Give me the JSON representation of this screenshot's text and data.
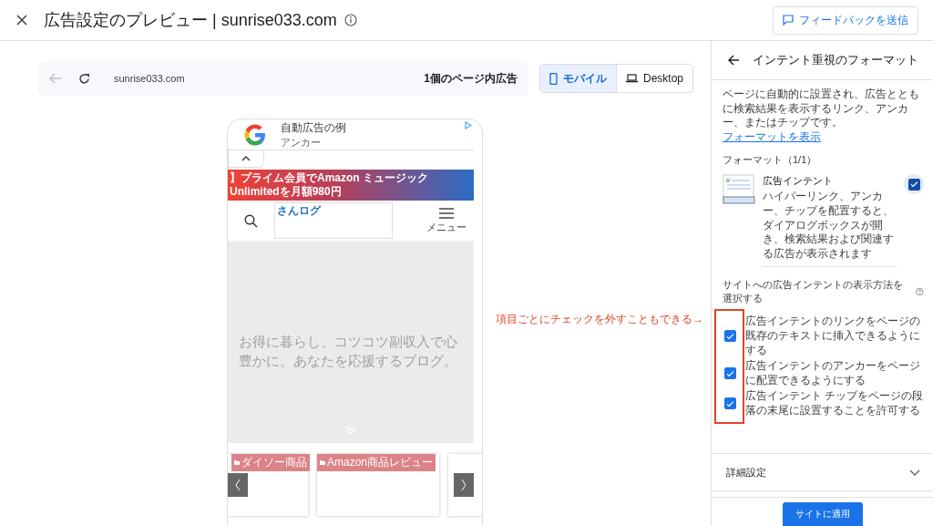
{
  "header": {
    "title": "広告設定のプレビュー | sunrise033.com",
    "feedback_button": "フィードバックを送信"
  },
  "browser_bar": {
    "url": "sunrise033.com",
    "ad_count": "1個のページ内広告",
    "back_disabled": true
  },
  "device_tabs": [
    {
      "label": "モバイル",
      "kind": "mobile",
      "selected": true
    },
    {
      "label": "Desktop",
      "kind": "desktop",
      "selected": false
    }
  ],
  "preview": {
    "anchor_ad": {
      "title": "自動広告の例",
      "subtitle": "アンカー"
    },
    "banner": "】プライム会員でAmazon ミュージック Unlimitedを月額980円",
    "site_logo": "さんログ",
    "menu_label": "メニュー",
    "hero_text": "お得に暮らし、コツコツ副収入で心豊かに。あなたを応援するブログ。",
    "carousel_tags": [
      "ダイソー商品",
      "Amazon商品レビュー"
    ]
  },
  "panel": {
    "title": "インテント重視のフォーマット",
    "description": "ページに自動的に設置され、広告とともに検索結果を表示するリンク、アンカー、またはチップです。",
    "description_link": "フォーマットを表示",
    "formats_heading": "フォーマット（1/1）",
    "format": {
      "title": "広告インテント",
      "description": "ハイパーリンク、アンカー、チップを配置すると、ダイアログボックスが開き、検索結果および関連する広告が表示されます",
      "checked": true
    },
    "options_heading": "サイトへの広告インテントの表示方法を選択する",
    "options": [
      {
        "label": "広告インテントのリンクをページの既存のテキストに挿入できるようにする",
        "checked": true
      },
      {
        "label": "広告インテントのアンカーをページに配置できるようにする",
        "checked": true
      },
      {
        "label": "広告インテント チップをページの段落の末尾に設置することを許可する",
        "checked": true
      }
    ],
    "advanced": {
      "label": "詳細設定",
      "expanded": false
    },
    "apply_button": "サイトに適用"
  },
  "annotation": "項目ごとにチェックを外すこともできる→"
}
